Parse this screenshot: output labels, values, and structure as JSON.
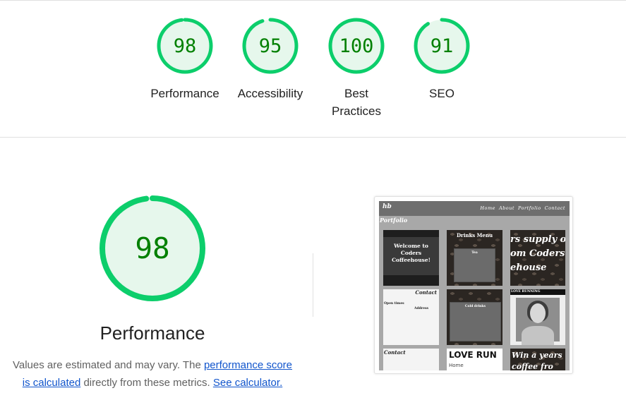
{
  "scores": [
    {
      "value": "98",
      "label": "Performance",
      "fraction": 0.98
    },
    {
      "value": "95",
      "label": "Accessibility",
      "fraction": 0.95
    },
    {
      "value": "100",
      "label": "Best Practices",
      "fraction": 1.0
    },
    {
      "value": "91",
      "label": "SEO",
      "fraction": 0.91
    }
  ],
  "colors": {
    "pass": "#0cce6b",
    "pass_fill": "#e6f7ec",
    "score_text": "#008000",
    "link": "#1155cc"
  },
  "performance": {
    "score": "98",
    "fraction": 0.98,
    "title": "Performance",
    "desc_prefix": "Values are estimated and may vary. The ",
    "link_score": "performance score is calculated",
    "desc_middle": " directly from these metrics. ",
    "link_calc": "See calculator."
  },
  "screenshot": {
    "logo": "hb",
    "nav_links": [
      "Home",
      "About",
      "Portfolio",
      "Contact"
    ],
    "heading": "Portfolio",
    "tiles": {
      "welcome": "Welcome to Coders Coffeehouse!",
      "drinks_menu": "Drinks Menu",
      "tea": "Tea",
      "supply_line1": "rs supply of",
      "supply_line2": "om Coders",
      "supply_line3": "ehouse",
      "contact": "Contact",
      "open_times": "Open times",
      "address": "Address",
      "cold_drinks": "Cold drinks",
      "love_running": "LOVE RUNNING",
      "contact2": "Contact",
      "love_run": "LOVE RUN",
      "home": "Home",
      "win_line1": "Win a years",
      "win_line2": "coffee fro"
    }
  }
}
